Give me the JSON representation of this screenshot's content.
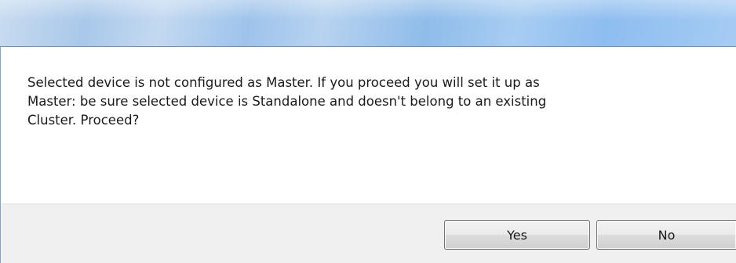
{
  "dialog": {
    "message": "Selected device is not configured as Master. If you proceed you will set it up as\nMaster: be sure selected device is Standalone and doesn't belong to an existing\nCluster. Proceed?",
    "buttons": {
      "yes_label": "Yes",
      "no_label": "No"
    }
  }
}
